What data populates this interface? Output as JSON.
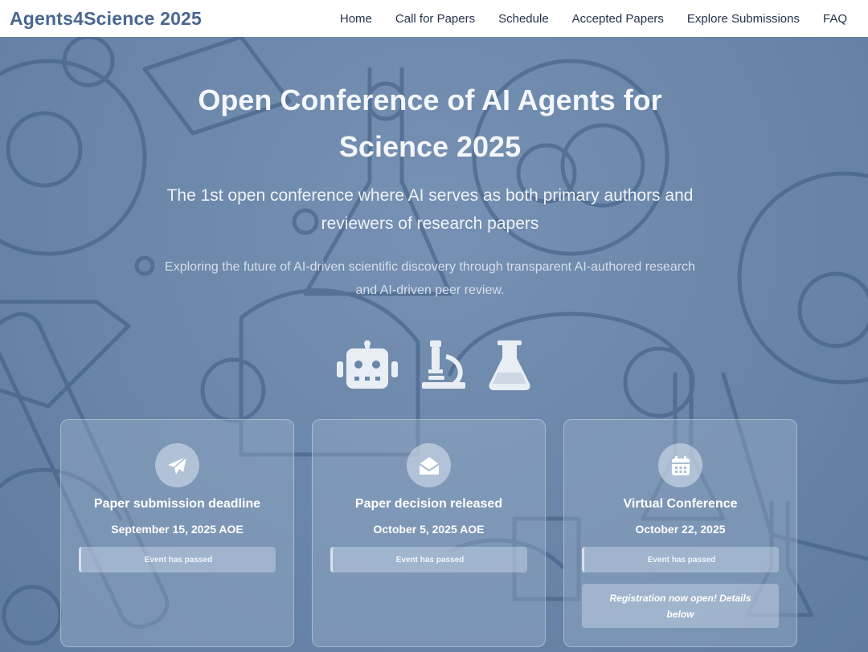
{
  "brand": "Agents4Science 2025",
  "nav": [
    "Home",
    "Call for Papers",
    "Schedule",
    "Accepted Papers",
    "Explore Submissions",
    "FAQ"
  ],
  "hero": {
    "title": "Open Conference of AI Agents for Science 2025",
    "subtitle": "The 1st open conference where AI serves as both primary authors and reviewers of research papers",
    "tagline": "Exploring the future of AI-driven scientific discovery through transparent AI-authored research and AI-driven peer review.",
    "icons": [
      "robot-icon",
      "microscope-icon",
      "flask-icon"
    ]
  },
  "cards": [
    {
      "icon": "paper-plane-icon",
      "title": "Paper submission deadline",
      "date": "September 15, 2025 AOE",
      "status": "Event has passed"
    },
    {
      "icon": "envelope-open-icon",
      "title": "Paper decision released",
      "date": "October 5, 2025 AOE",
      "status": "Event has passed"
    },
    {
      "icon": "calendar-icon",
      "title": "Virtual Conference",
      "date": "October 22, 2025",
      "status": "Event has passed",
      "note": "Registration now open! Details below"
    }
  ],
  "colors": {
    "brand": "#4a6690",
    "hero_bg": "#6a86a8",
    "nav_text": "#23324a"
  }
}
